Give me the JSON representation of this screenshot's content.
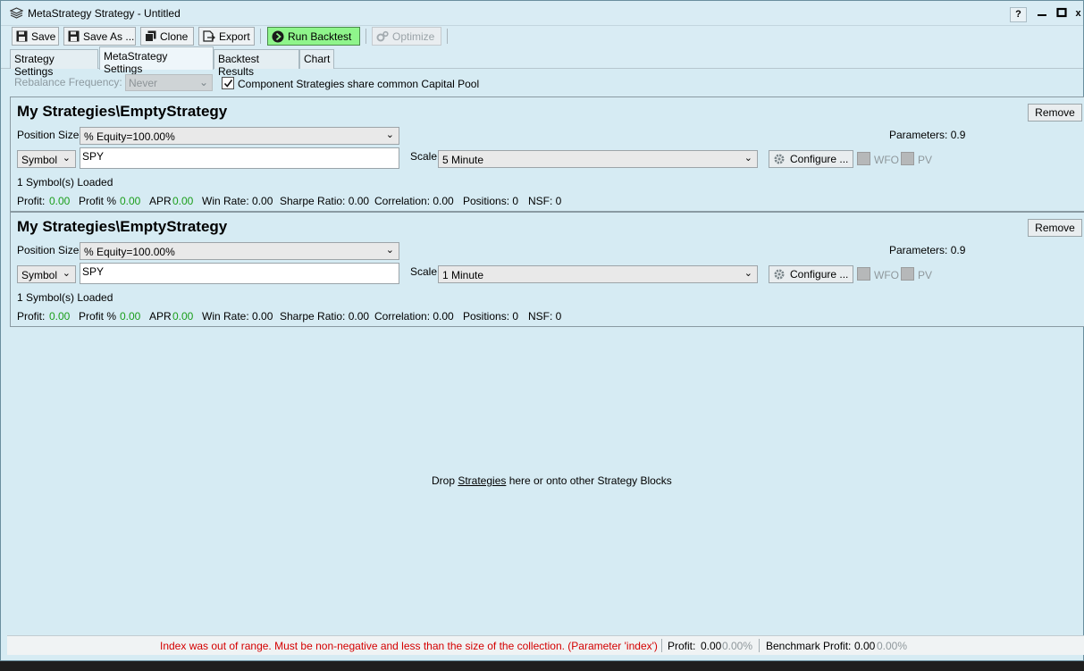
{
  "window": {
    "title": "MetaStrategy Strategy - Untitled",
    "help": "?",
    "minimize": "_",
    "maximize": "□",
    "close": "x"
  },
  "toolbar": {
    "save": "Save",
    "save_as": "Save As ...",
    "clone": "Clone",
    "export": "Export",
    "run_backtest": "Run Backtest",
    "optimize": "Optimize"
  },
  "tabs": [
    {
      "label": "Strategy Settings",
      "active": false
    },
    {
      "label": "MetaStrategy Settings",
      "active": true
    },
    {
      "label": "Backtest Results",
      "active": false
    },
    {
      "label": "Chart",
      "active": false
    }
  ],
  "settings": {
    "rebalance_label": "Rebalance Frequency:",
    "rebalance_value": "Never",
    "share_pool_label": "Component Strategies share common Capital Pool",
    "share_pool_checked": true
  },
  "blocks": [
    {
      "name": "My Strategies\\EmptyStrategy",
      "remove": "Remove",
      "position_size_label": "Position Size",
      "position_size_value": "% Equity=100.00%",
      "parameters": "Parameters: 0.9",
      "symbol_mode": "Symbol",
      "symbol_value": "SPY",
      "scale_label": "Scale",
      "scale_value": "5 Minute",
      "configure": "Configure ...",
      "wfo": "WFO",
      "pv": "PV",
      "loaded": "1 Symbol(s) Loaded",
      "stats": {
        "profit_label": "Profit:",
        "profit": "0.00",
        "profit_pct_label": "Profit %",
        "profit_pct": "0.00",
        "apr_label": "APR",
        "apr": "0.00",
        "win_rate": "Win Rate: 0.00",
        "sharpe": "Sharpe Ratio: 0.00",
        "correlation": "Correlation: 0.00",
        "positions": "Positions: 0",
        "nsf": "NSF: 0"
      }
    },
    {
      "name": "My Strategies\\EmptyStrategy",
      "remove": "Remove",
      "position_size_label": "Position Size",
      "position_size_value": "% Equity=100.00%",
      "parameters": "Parameters: 0.9",
      "symbol_mode": "Symbol",
      "symbol_value": "SPY",
      "scale_label": "Scale",
      "scale_value": "1 Minute",
      "configure": "Configure ...",
      "wfo": "WFO",
      "pv": "PV",
      "loaded": "1 Symbol(s) Loaded",
      "stats": {
        "profit_label": "Profit:",
        "profit": "0.00",
        "profit_pct_label": "Profit %",
        "profit_pct": "0.00",
        "apr_label": "APR",
        "apr": "0.00",
        "win_rate": "Win Rate: 0.00",
        "sharpe": "Sharpe Ratio: 0.00",
        "correlation": "Correlation: 0.00",
        "positions": "Positions: 0",
        "nsf": "NSF: 0"
      }
    }
  ],
  "drop_area": {
    "before": "Drop ",
    "link": "Strategies",
    "after": " here or onto other Strategy Blocks"
  },
  "status": {
    "error": "Index was out of range. Must be non-negative and less than the size of the collection. (Parameter 'index')",
    "profit_label": "Profit:",
    "profit": "0.00",
    "profit_pct": "0.00%",
    "benchmark_label": "Benchmark Profit:",
    "benchmark": "0.00",
    "benchmark_pct": "0.00%"
  },
  "colors": {
    "background": "#d6ebf3",
    "run_button": "#8ff58b",
    "positive_value": "#1b9e1b",
    "error_text": "#d40000"
  }
}
